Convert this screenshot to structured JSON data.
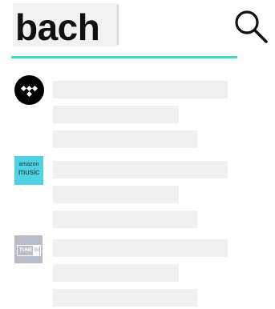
{
  "search": {
    "query": "bach",
    "icon": "search-icon",
    "underline_color": "#3fd9c2"
  },
  "results": [
    {
      "service_icon": "tidal-logo-icon",
      "status": "loading"
    },
    {
      "service_icon": "amazon-music-logo-icon",
      "logo_text_top": "amazon",
      "logo_text_bottom": "music",
      "status": "loading"
    },
    {
      "service_icon": "tunein-logo-icon",
      "logo_text_left": "TUNE",
      "logo_text_right": "IN",
      "status": "loading"
    }
  ],
  "colors": {
    "skeleton": "#f0f0f0",
    "tidal": "#000000",
    "amazon": "#4fd3e3",
    "tunein": "#b9bcc9"
  }
}
